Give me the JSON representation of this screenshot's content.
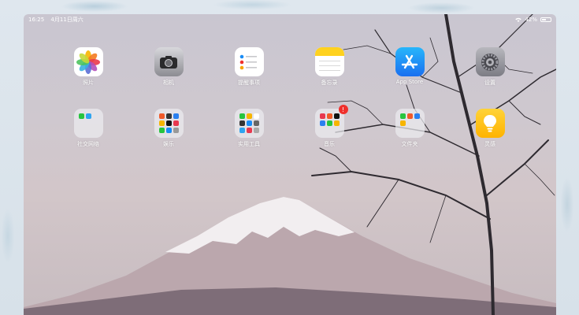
{
  "status_bar": {
    "time": "16:25",
    "date": "4月11日周六",
    "battery": "42%",
    "battery_level": 0.42
  },
  "apps_row1": [
    {
      "label": "照片",
      "icon": "photos-icon"
    },
    {
      "label": "相机",
      "icon": "camera-icon"
    },
    {
      "label": "提醒事项",
      "icon": "reminders-icon"
    },
    {
      "label": "备忘录",
      "icon": "notes-icon"
    },
    {
      "label": "App Store",
      "icon": "app-store-icon"
    },
    {
      "label": "设置",
      "icon": "settings-icon"
    }
  ],
  "apps_row2": [
    {
      "label": "社交网络",
      "icon": "social-folder-icon"
    },
    {
      "label": "娱乐",
      "icon": "entertainment-folder-icon"
    },
    {
      "label": "实用工具",
      "icon": "utilities-folder-icon"
    },
    {
      "label": "音乐",
      "icon": "music-folder-icon",
      "badge": "!"
    },
    {
      "label": "文件夹",
      "icon": "folder-icon"
    },
    {
      "label": "灵感",
      "icon": "tips-icon"
    }
  ],
  "colors": {
    "accent_red": "#f0302c",
    "app_store_blue": "#1a8cf5",
    "notes_yellow": "#ffd21f",
    "tips_yellow": "#ffc20e"
  }
}
